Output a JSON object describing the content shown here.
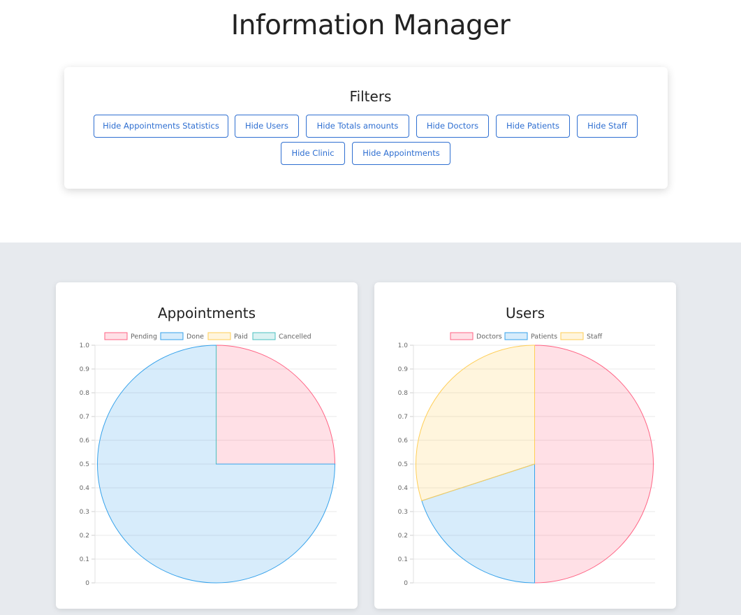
{
  "page": {
    "title": "Information Manager"
  },
  "filters": {
    "title": "Filters",
    "buttons": [
      "Hide Appointments Statistics",
      "Hide Users",
      "Hide Totals amounts",
      "Hide Doctors",
      "Hide Patients",
      "Hide Staff",
      "Hide Clinic",
      "Hide Appointments"
    ]
  },
  "colors": {
    "accent": "#2f6fd1",
    "section_bg": "#e7eaee",
    "pink": "#ff6384",
    "blue": "#36a2eb",
    "yellow": "#ffce56",
    "teal": "#4bc0c0"
  },
  "chart_data": [
    {
      "type": "pie",
      "title": "Appointments",
      "categories": [
        "Pending",
        "Done",
        "Paid",
        "Cancelled"
      ],
      "values": [
        1,
        3,
        0,
        0
      ],
      "colors": [
        "#ff6384",
        "#36a2eb",
        "#ffce56",
        "#4bc0c0"
      ],
      "y_ticks": [
        "1.0",
        "0.9",
        "0.8",
        "0.7",
        "0.6",
        "0.5",
        "0.4",
        "0.3",
        "0.2",
        "0.1",
        "0"
      ],
      "ylim": [
        0,
        1
      ],
      "grid": true,
      "legend": "top"
    },
    {
      "type": "pie",
      "title": "Users",
      "categories": [
        "Doctors",
        "Patients",
        "Staff"
      ],
      "values": [
        5,
        2,
        3
      ],
      "colors": [
        "#ff6384",
        "#36a2eb",
        "#ffce56"
      ],
      "y_ticks": [
        "1.0",
        "0.9",
        "0.8",
        "0.7",
        "0.6",
        "0.5",
        "0.4",
        "0.3",
        "0.2",
        "0.1",
        "0"
      ],
      "ylim": [
        0,
        1
      ],
      "grid": true,
      "legend": "top"
    }
  ]
}
